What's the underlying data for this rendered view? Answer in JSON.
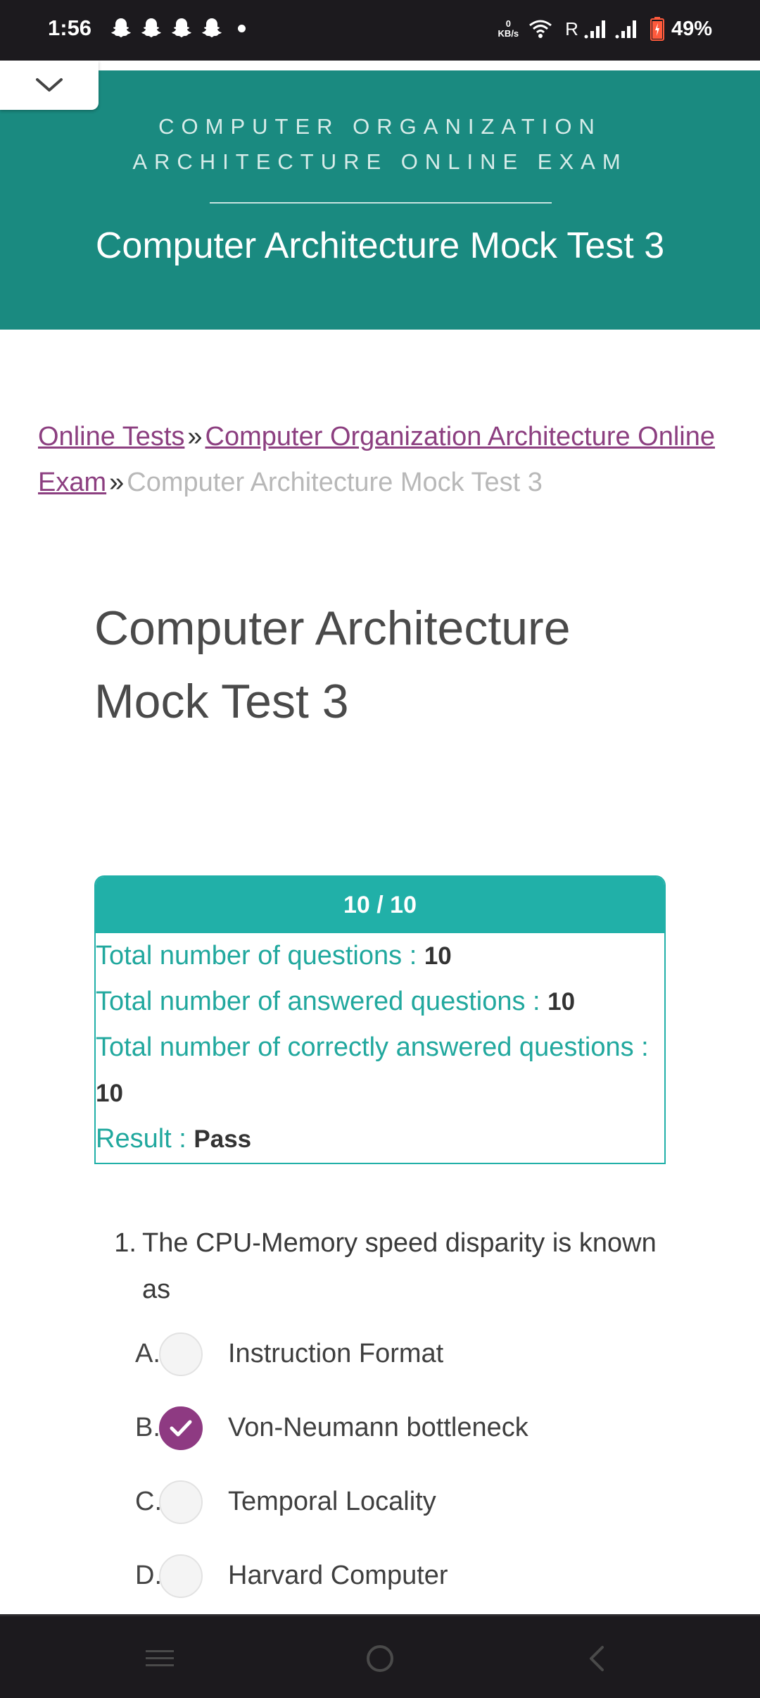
{
  "status_bar": {
    "time": "1:56",
    "net_speed_value": "0",
    "net_speed_unit": "KB/s",
    "roaming": "R",
    "battery": "49%",
    "notification_icons": [
      "snapchat-icon",
      "snapchat-icon",
      "snapchat-icon",
      "snapchat-icon"
    ]
  },
  "banner": {
    "category": "COMPUTER ORGANIZATION ARCHITECTURE ONLINE EXAM",
    "title": "Computer Architecture Mock Test 3"
  },
  "breadcrumb": {
    "items": [
      {
        "label": "Online Tests"
      },
      {
        "label": "Computer Organization Architecture Online Exam"
      }
    ],
    "separator": "»",
    "current": "Computer Architecture Mock Test 3"
  },
  "page_title": "Computer Architecture Mock Test 3",
  "result": {
    "score": "10 / 10",
    "rows": [
      {
        "label": "Total number of questions : ",
        "value": "10"
      },
      {
        "label": "Total number of answered questions : ",
        "value": "10"
      },
      {
        "label": "Total number of correctly answered questions : ",
        "value": "10"
      },
      {
        "label": "Result : ",
        "value": "Pass"
      }
    ]
  },
  "question": {
    "number": "1.",
    "text": "The CPU-Memory speed disparity is known as",
    "options": [
      {
        "letter": "A.",
        "text": "Instruction Format",
        "selected": false
      },
      {
        "letter": "B.",
        "text": "Von-Neumann bottleneck",
        "selected": true
      },
      {
        "letter": "C.",
        "text": "Temporal Locality",
        "selected": false
      },
      {
        "letter": "D.",
        "text": "Harvard Computer",
        "selected": false
      }
    ]
  },
  "colors": {
    "banner": "#1a8a80",
    "accent_teal": "#21b0a8",
    "link_purple": "#8c3f80",
    "selected_radio": "#8e3a82"
  }
}
